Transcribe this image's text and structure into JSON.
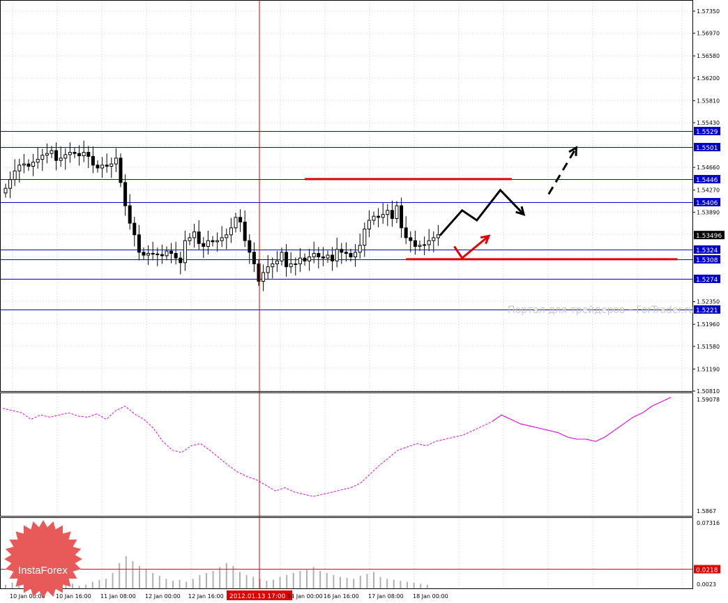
{
  "watermark": "Портал для трейдеров – ForTrader.ru",
  "logo_text": "InstaForex",
  "colors": {
    "level_line": "#0000c8",
    "level_label_bg": "#0000c8",
    "red": "#e00000",
    "forecast_black": "#000000",
    "indicator": "#e000e0",
    "grid": "#c0c8d8",
    "logo": "#e85a5a"
  },
  "chart_data": [
    {
      "type": "candlestick",
      "panel": "price",
      "y_ticks": [
        "1.57350",
        "1.56970",
        "1.56580",
        "1.56200",
        "1.55810",
        "1.55430",
        "1.54660",
        "1.54270",
        "1.53890",
        "1.52350",
        "1.51960",
        "1.51580",
        "1.51190",
        "1.50810"
      ],
      "ylim": [
        1.5081,
        1.5752
      ],
      "current_price": "1.53496",
      "levels": [
        {
          "label": "1.5529",
          "value": 1.5529
        },
        {
          "label": "1.5501",
          "value": 1.5501
        },
        {
          "label": "1.5446",
          "value": 1.5446
        },
        {
          "label": "1.5406",
          "value": 1.5406
        },
        {
          "label": "1.5324",
          "value": 1.5324
        },
        {
          "label": "1.5308",
          "value": 1.5308
        },
        {
          "label": "1.5274",
          "value": 1.5274
        },
        {
          "label": "1.5221",
          "value": 1.5221
        }
      ],
      "red_lines": [
        {
          "from_bar": 65,
          "to_bar": 110,
          "value": 1.5446
        },
        {
          "from_bar": 87,
          "to_bar": 146,
          "value": 1.5308
        }
      ],
      "closes": [
        1.543,
        1.5445,
        1.546,
        1.547,
        1.5472,
        1.5468,
        1.5475,
        1.548,
        1.5487,
        1.549,
        1.5495,
        1.5478,
        1.5482,
        1.5488,
        1.5492,
        1.549,
        1.5486,
        1.5492,
        1.5485,
        1.547,
        1.5465,
        1.547,
        1.5468,
        1.5472,
        1.5482,
        1.544,
        1.54,
        1.537,
        1.535,
        1.532,
        1.5315,
        1.5318,
        1.5317,
        1.5316,
        1.5314,
        1.5322,
        1.5318,
        1.531,
        1.5302,
        1.534,
        1.5345,
        1.5355,
        1.5335,
        1.533,
        1.534,
        1.5338,
        1.534,
        1.5345,
        1.535,
        1.5362,
        1.538,
        1.5372,
        1.534,
        1.532,
        1.53,
        1.527,
        1.5285,
        1.5295,
        1.53,
        1.5305,
        1.532,
        1.5295,
        1.53,
        1.53,
        1.531,
        1.5305,
        1.5312,
        1.5318,
        1.5312,
        1.531,
        1.5315,
        1.5305,
        1.5325,
        1.532,
        1.5318,
        1.5312,
        1.532,
        1.5332,
        1.536,
        1.5375,
        1.5382,
        1.538,
        1.5385,
        1.5392,
        1.5378,
        1.54,
        1.5362,
        1.5345,
        1.534,
        1.533,
        1.5332,
        1.5333,
        1.534,
        1.5345,
        1.535
      ],
      "bar_spacing_px": 6.6,
      "forecast_black": [
        [
          94.4,
          1.5349
        ],
        [
          99.2,
          1.5392
        ],
        [
          102.4,
          1.5375
        ],
        [
          107.5,
          1.5427
        ],
        [
          112.6,
          1.5385
        ]
      ],
      "forecast_black_dashed": [
        [
          118,
          1.542
        ],
        [
          124,
          1.55
        ]
      ],
      "forecast_red": [
        [
          97.5,
          1.533
        ],
        [
          99.2,
          1.531
        ],
        [
          105,
          1.5348
        ]
      ]
    },
    {
      "type": "line",
      "panel": "indicator",
      "y_ticks": [
        "1.59078",
        "1.5867"
      ],
      "ylim": [
        1.5867,
        1.59078
      ],
      "series": [
        {
          "values": [
            0.9,
            0.88,
            0.86,
            0.8,
            0.84,
            0.82,
            0.84,
            0.86,
            0.83,
            0.82,
            0.85,
            0.8,
            0.88,
            0.92,
            0.85,
            0.8,
            0.72,
            0.6,
            0.52,
            0.5,
            0.56,
            0.58,
            0.52,
            0.45,
            0.38,
            0.32,
            0.28,
            0.25,
            0.2,
            0.15,
            0.18,
            0.14,
            0.12,
            0.1,
            0.12,
            0.14,
            0.16,
            0.18,
            0.22,
            0.3,
            0.38,
            0.45,
            0.52,
            0.55,
            0.58,
            0.56,
            0.6,
            0.62,
            0.64,
            0.66,
            0.7,
            0.74,
            0.78,
            0.84,
            0.8,
            0.76,
            0.74,
            0.72,
            0.7,
            0.68,
            0.64,
            0.62,
            0.62,
            0.6,
            0.64,
            0.7,
            0.76,
            0.82,
            0.86,
            0.92,
            0.96,
            1.0
          ]
        }
      ]
    },
    {
      "type": "bar",
      "panel": "volume",
      "y_ticks": [
        "0.07316",
        "0.0023"
      ],
      "ylim": [
        0.0023,
        0.07316
      ],
      "level": {
        "label": "0.0218",
        "value": 0.0218
      },
      "values": [
        0.006,
        0.008,
        0.005,
        0.007,
        0.009,
        0.006,
        0.005,
        0.007,
        0.006,
        0.008,
        0.007,
        0.005,
        0.006,
        0.009,
        0.011,
        0.012,
        0.018,
        0.028,
        0.035,
        0.03,
        0.025,
        0.022,
        0.018,
        0.015,
        0.012,
        0.01,
        0.011,
        0.009,
        0.012,
        0.016,
        0.018,
        0.02,
        0.024,
        0.028,
        0.025,
        0.019,
        0.016,
        0.014,
        0.012,
        0.01,
        0.011,
        0.014,
        0.016,
        0.018,
        0.02,
        0.022,
        0.024,
        0.02,
        0.018,
        0.016,
        0.014,
        0.013,
        0.012,
        0.015,
        0.017,
        0.019,
        0.014,
        0.012,
        0.011,
        0.01,
        0.009,
        0.008,
        0.007,
        0.006
      ]
    }
  ],
  "x_labels": [
    "10 Jan 00:00",
    "10 Jan 16:00",
    "11 Jan 08:00",
    "12 Jan 00:00",
    "12 Jan 16:00",
    "2012.01.13 17:00",
    "14 Jan 00:00",
    "16 Jan 16:00",
    "17 Jan 08:00",
    "18 Jan 00:00"
  ],
  "cursor_label": "2012.01.13 17:00"
}
